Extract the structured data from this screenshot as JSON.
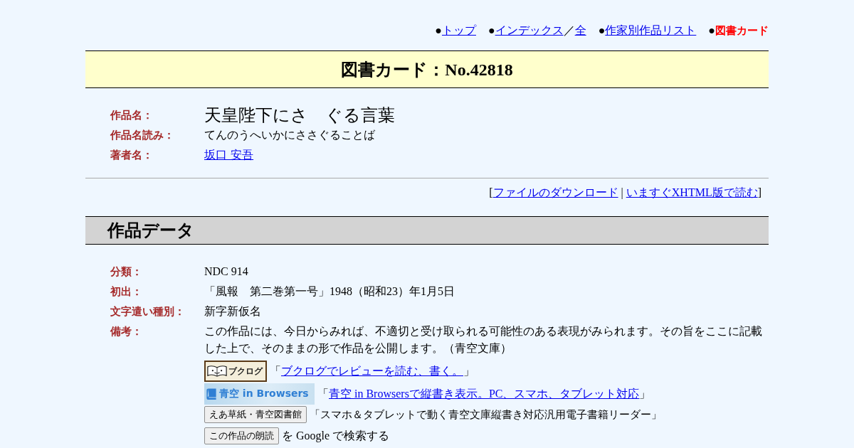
{
  "nav": [
    {
      "bullet": "●",
      "parts": [
        {
          "kind": "link",
          "text": "トップ"
        }
      ]
    },
    {
      "bullet": "●",
      "parts": [
        {
          "kind": "link",
          "text": "インデックス"
        },
        {
          "kind": "text",
          "text": "／"
        },
        {
          "kind": "link",
          "text": "全"
        }
      ]
    },
    {
      "bullet": "●",
      "parts": [
        {
          "kind": "link",
          "text": "作家別作品リスト"
        }
      ]
    },
    {
      "bullet": "●",
      "parts": [
        {
          "kind": "current",
          "text": "図書カード"
        }
      ]
    }
  ],
  "card_title": "図書カード：No.42818",
  "work_info": [
    {
      "label": "作品名：",
      "kind": "title",
      "value": "天皇陛下にさ　ぐる言葉"
    },
    {
      "label": "作品名読み：",
      "kind": "text",
      "value": "てんのうへいかにささぐることば"
    },
    {
      "label": "著者名：",
      "kind": "link",
      "value": "坂口 安吾"
    }
  ],
  "downloads": {
    "open": "[",
    "links": [
      "ファイルのダウンロード",
      "いますぐXHTML版で読む"
    ],
    "separator": "|",
    "close": "]"
  },
  "work_data": {
    "heading": "作品データ",
    "rows": [
      {
        "label": "分類：",
        "value": "NDC 914"
      },
      {
        "label": "初出：",
        "value": "「風報　第二巻第一号」1948（昭和23）年1月5日"
      },
      {
        "label": "文字遣い種別：",
        "value": "新字新仮名"
      },
      {
        "label": "備考：",
        "value": "この作品には、今日からみれば、不適切と受け取られる可能性のある表現がみられます。その旨をここに記載した上で、そのままの形で作品を公開します。（青空文庫）"
      }
    ],
    "services": [
      {
        "kind": "booklog",
        "badge": "ブクログ",
        "open": "「",
        "link": "ブクログでレビューを読む、書く。",
        "close": "」"
      },
      {
        "kind": "browsers",
        "badge": "青空 in Browsers",
        "open": "「",
        "link": "青空 in Browsersで縦書き表示。PC、スマホ、タブレット対応",
        "close": "」"
      },
      {
        "kind": "button",
        "button": "えあ草紙・青空図書館",
        "text": "「スマホ＆タブレットで動く青空文庫縦書き対応汎用電子書籍リーダー」"
      },
      {
        "kind": "search",
        "button": "この作品の朗読",
        "text": "を Google で検索する"
      }
    ]
  }
}
